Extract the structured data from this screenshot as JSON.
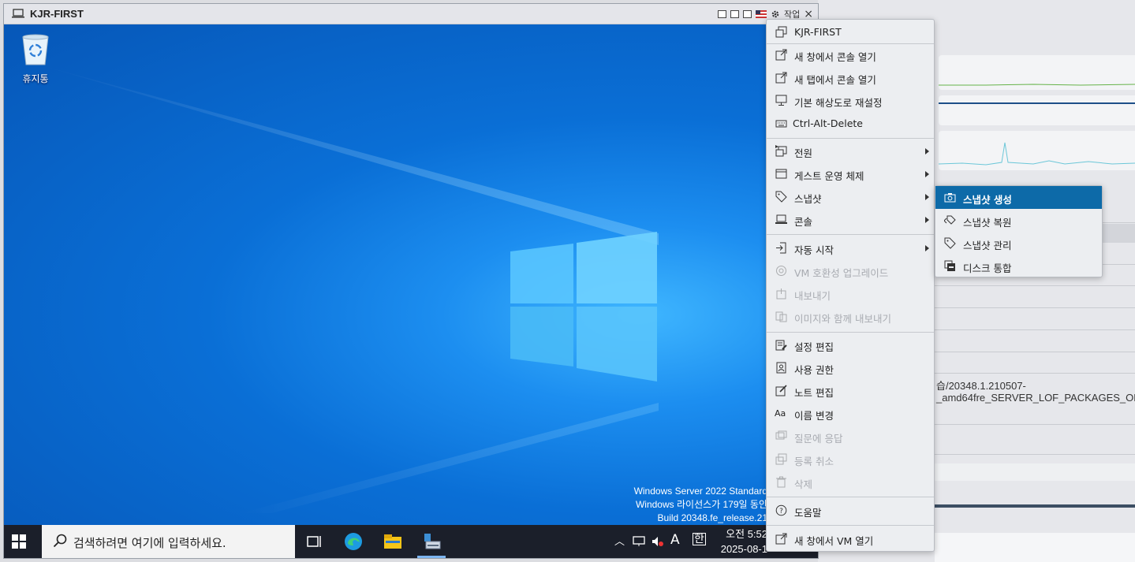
{
  "window": {
    "title": "KJR-FIRST",
    "actions_label": "작업"
  },
  "desktop": {
    "recycle_bin_label": "휴지통",
    "watermark_line1": "Windows Server 2022 Standard",
    "watermark_line2": "Windows 라이선스가 179일 동안",
    "watermark_line3": "Build 20348.fe_release.21"
  },
  "taskbar": {
    "search_placeholder": "검색하려면 여기에 입력하세요.",
    "ime_label": "A",
    "ime_hangul": "한",
    "clock_time": "오전 5:52",
    "clock_date": "2025-08-1"
  },
  "menu": {
    "header": "KJR-FIRST",
    "items": [
      {
        "label": "새 창에서 콘솔 열기"
      },
      {
        "label": "새 탭에서 콘솔 열기"
      },
      {
        "label": "기본 해상도로 재설정"
      },
      {
        "label": "Ctrl-Alt-Delete"
      },
      {
        "label": "전원"
      },
      {
        "label": "게스트 운영 체제"
      },
      {
        "label": "스냅샷"
      },
      {
        "label": "콘솔"
      },
      {
        "label": "자동 시작"
      },
      {
        "label": "VM 호환성 업그레이드"
      },
      {
        "label": "내보내기"
      },
      {
        "label": "이미지와 함께 내보내기"
      },
      {
        "label": "설정 편집"
      },
      {
        "label": "사용 권한"
      },
      {
        "label": "노트 편집"
      },
      {
        "label": "이름 변경"
      },
      {
        "label": "질문에 응답"
      },
      {
        "label": "등록 취소"
      },
      {
        "label": "삭제"
      },
      {
        "label": "도움말"
      },
      {
        "label": "새 창에서 VM 열기"
      }
    ]
  },
  "submenu": {
    "items": [
      {
        "label": "스냅샷 생성"
      },
      {
        "label": "스냅샷 복원"
      },
      {
        "label": "스냅샷 관리"
      },
      {
        "label": "디스크 통합"
      }
    ]
  },
  "background": {
    "text1": "습/20348.1.210507-",
    "text2": "_amd64fre_SERVER_LOF_PACKAGES_OE"
  },
  "colors": {
    "menu_highlight": "#0d6aa8",
    "desktop_blue": "#0a70d6",
    "taskbar": "#1b1f2a"
  }
}
